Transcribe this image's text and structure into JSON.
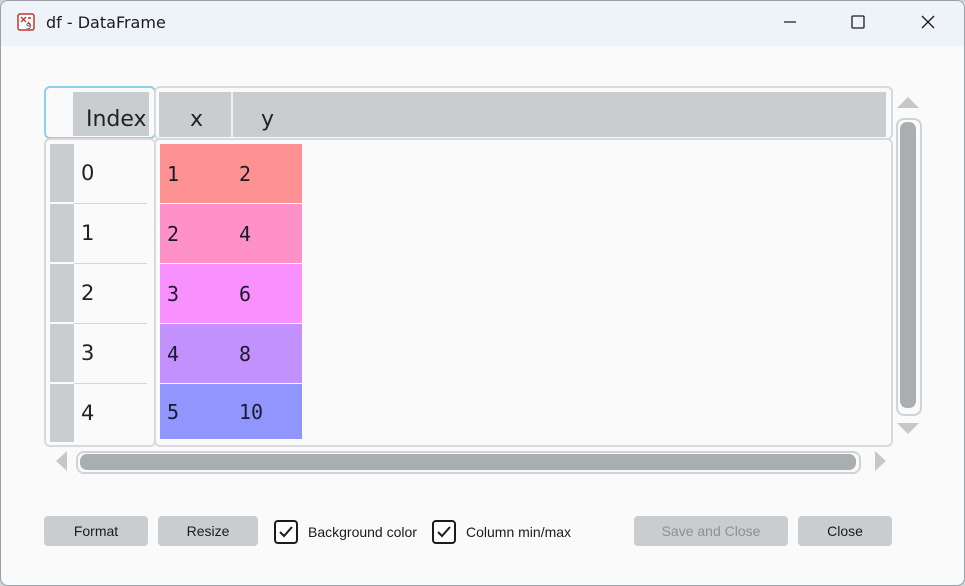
{
  "window": {
    "title": "df - DataFrame",
    "icon": "spyder-app-icon"
  },
  "titlebar_controls": [
    "minimize-icon",
    "maximize-icon",
    "close-icon"
  ],
  "table": {
    "index_header": "Index",
    "columns": [
      "x",
      "y"
    ],
    "index": [
      "0",
      "1",
      "2",
      "3",
      "4"
    ],
    "rows": [
      [
        "1",
        "2"
      ],
      [
        "2",
        "4"
      ],
      [
        "3",
        "6"
      ],
      [
        "4",
        "8"
      ],
      [
        "5",
        "10"
      ]
    ],
    "row_colors": [
      "#fe9191",
      "#fe91c8",
      "#f891fe",
      "#c391fe",
      "#9196fe"
    ]
  },
  "footer": {
    "format_label": "Format",
    "resize_label": "Resize",
    "background_color_label": "Background color",
    "background_color_checked": true,
    "column_minmax_label": "Column min/max",
    "column_minmax_checked": true,
    "save_close_label": "Save and Close",
    "close_label": "Close"
  }
}
